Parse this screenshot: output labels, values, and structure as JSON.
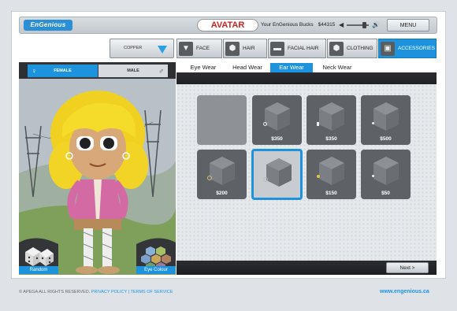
{
  "header": {
    "logo_text": "EnGenious",
    "title": "AVATAR",
    "bucks_label": "Your EnGenious Bucks",
    "bucks_value": "$44315",
    "menu_label": "MENU"
  },
  "colors": {
    "accent": "#1d93de",
    "title_red": "#d42020",
    "panel_dark": "#2d2f32"
  },
  "color_picker": {
    "value": "COPPER"
  },
  "gender": {
    "female_label": "FEMALE",
    "male_label": "MALE",
    "selected": "FEMALE"
  },
  "categories": [
    {
      "label": "FACE",
      "icon": "face-icon"
    },
    {
      "label": "HAIR",
      "icon": "hair-icon"
    },
    {
      "label": "FACIAL HAIR",
      "icon": "facial-hair-icon"
    },
    {
      "label": "CLOTHING",
      "icon": "clothing-icon"
    },
    {
      "label": "ACCESSORIES",
      "icon": "accessories-icon",
      "active": true
    }
  ],
  "subcategories": [
    {
      "label": "Eye Wear"
    },
    {
      "label": "Head Wear"
    },
    {
      "label": "Ear Wear",
      "active": true
    },
    {
      "label": "Neck Wear"
    }
  ],
  "items": [
    {
      "price": ""
    },
    {
      "price": "$350"
    },
    {
      "price": "$350"
    },
    {
      "price": "$500"
    },
    {
      "price": "$200"
    },
    {
      "price": ""
    },
    {
      "price": "$150"
    },
    {
      "price": "$50"
    }
  ],
  "actions": {
    "random_label": "Random",
    "eye_colour_label": "Eye Colour",
    "next_label": "Next >"
  },
  "footer": {
    "copyright": "© APEGA ALL RIGHTS RESERVED.",
    "privacy": "PRIVACY POLICY",
    "separator": "|",
    "terms": "TERMS OF SERVICE",
    "site": "www.engenious.ca"
  }
}
